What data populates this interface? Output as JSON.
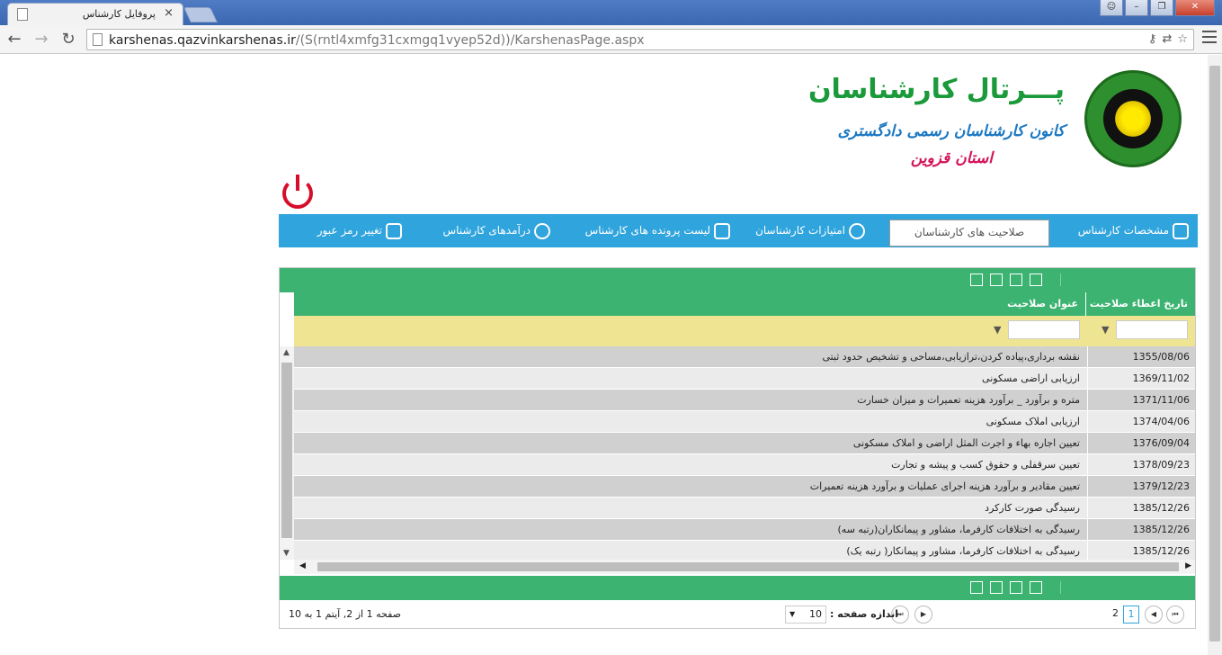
{
  "browser": {
    "tab_title": "پروفایل کارشناس",
    "tab_close": "×",
    "url_host": "karshenas.qazvinkarshenas.ir",
    "url_path": "/(S(rntl4xmfg31cxmgq1vyep52d))/KarshenasPage.aspx"
  },
  "header": {
    "title": "پـــرتال کارشناسان",
    "subtitle": "کانون کارشناسان رسمی دادگستری",
    "province": "استان قزوین"
  },
  "menu": {
    "items": [
      {
        "label": "مشخصات کارشناس"
      },
      {
        "label": "صلاحیت های کارشناسان"
      },
      {
        "label": "امتیازات کارشناسان"
      },
      {
        "label": "لیست پرونده های کارشناس"
      },
      {
        "label": "درآمدهای کارشناس"
      },
      {
        "label": "تغییر رمز عبور"
      }
    ]
  },
  "grid": {
    "columns": [
      "تاریخ اعطاء صلاحیت",
      "عنوان صلاحیت"
    ],
    "rows": [
      {
        "date": "1355/08/06",
        "title": "نقشه برداری،پیاده کردن،ترازیابی،مساحی و تشخیص حدود ثبتی"
      },
      {
        "date": "1369/11/02",
        "title": "ارزیابی اراضی مسکونی"
      },
      {
        "date": "1371/11/06",
        "title": "متره و برآورد _ برآورد هزینه تعمیرات و میزان خسارت"
      },
      {
        "date": "1374/04/06",
        "title": "ارزیابی املاک مسکونی"
      },
      {
        "date": "1376/09/04",
        "title": "تعیین اجاره بهاء و اجرت المثل اراضی و املاک مسکونی"
      },
      {
        "date": "1378/09/23",
        "title": "تعیین سرقفلی و حقوق کسب و پیشه و تجارت"
      },
      {
        "date": "1379/12/23",
        "title": "تعیین مقادیر و برآورد هزینه اجرای عملیات و برآورد هزینه تعمیرات"
      },
      {
        "date": "1385/12/26",
        "title": "رسیدگی صورت کارکرد"
      },
      {
        "date": "1385/12/26",
        "title": "رسیدگی به اختلافات کارفرما، مشاور و پیمانکاران(رتبه سه)"
      },
      {
        "date": "1385/12/26",
        "title": "رسیدگی به اختلافات کارفرما، مشاور و پیمانکار( رتبه یک)"
      }
    ],
    "pager": {
      "page_current": "1",
      "page_other": "2",
      "page_size_label": "اندازه صفحه :",
      "page_size": "10",
      "summary": "صفحه 1 از 2, آیتم 1 به 10"
    }
  }
}
